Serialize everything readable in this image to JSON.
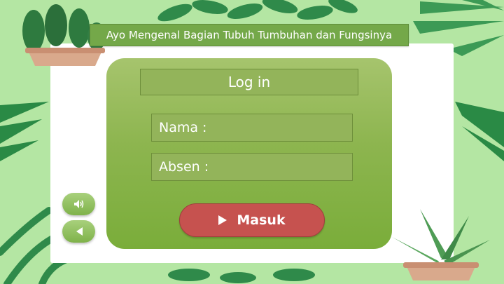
{
  "header": {
    "title": "Ayo Mengenal Bagian Tubuh Tumbuhan dan Fungsinya"
  },
  "login": {
    "heading": "Log in",
    "nama_label": "Nama :",
    "absen_label": "Absen :",
    "submit_label": "Masuk"
  },
  "controls": {
    "sound_icon": "speaker-icon",
    "back_icon": "back-triangle-icon"
  },
  "colors": {
    "background": "#b4e6a3",
    "banner": "#74a849",
    "card": "#8db54f",
    "submit_button": "#c6524f"
  }
}
